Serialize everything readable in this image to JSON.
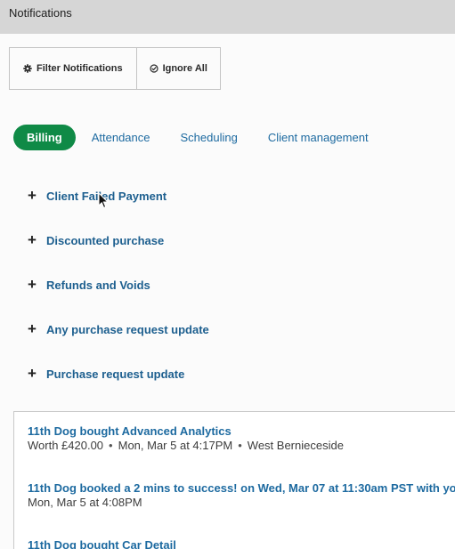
{
  "window": {
    "title": "Notifications"
  },
  "toolbar": {
    "filter_label": "Filter Notifications",
    "filter_icon": "gear-icon",
    "ignore_label": "Ignore All",
    "ignore_icon": "check-circle-icon"
  },
  "tabs": [
    {
      "label": "Billing",
      "active": true
    },
    {
      "label": "Attendance",
      "active": false
    },
    {
      "label": "Scheduling",
      "active": false
    },
    {
      "label": "Client management",
      "active": false
    }
  ],
  "categories": [
    {
      "label": "Client Failed Payment"
    },
    {
      "label": "Discounted purchase"
    },
    {
      "label": "Refunds and Voids"
    },
    {
      "label": "Any purchase request update"
    },
    {
      "label": "Purchase request update"
    }
  ],
  "feed": [
    {
      "title": "11th Dog bought Advanced Analytics",
      "worth": "Worth £420.00",
      "date": "Mon, Mar 5 at 4:17PM",
      "location": "West Bernieceside"
    },
    {
      "title": "11th Dog booked a 2 mins to success! on Wed, Mar 07 at 11:30am PST with yo",
      "date": "Mon, Mar 5 at 4:08PM"
    },
    {
      "title": "11th Dog bought Car Detail"
    }
  ],
  "colors": {
    "accent": "#0f8a46",
    "link": "#1d6aa0",
    "titlebar": "#d6d6d6"
  }
}
